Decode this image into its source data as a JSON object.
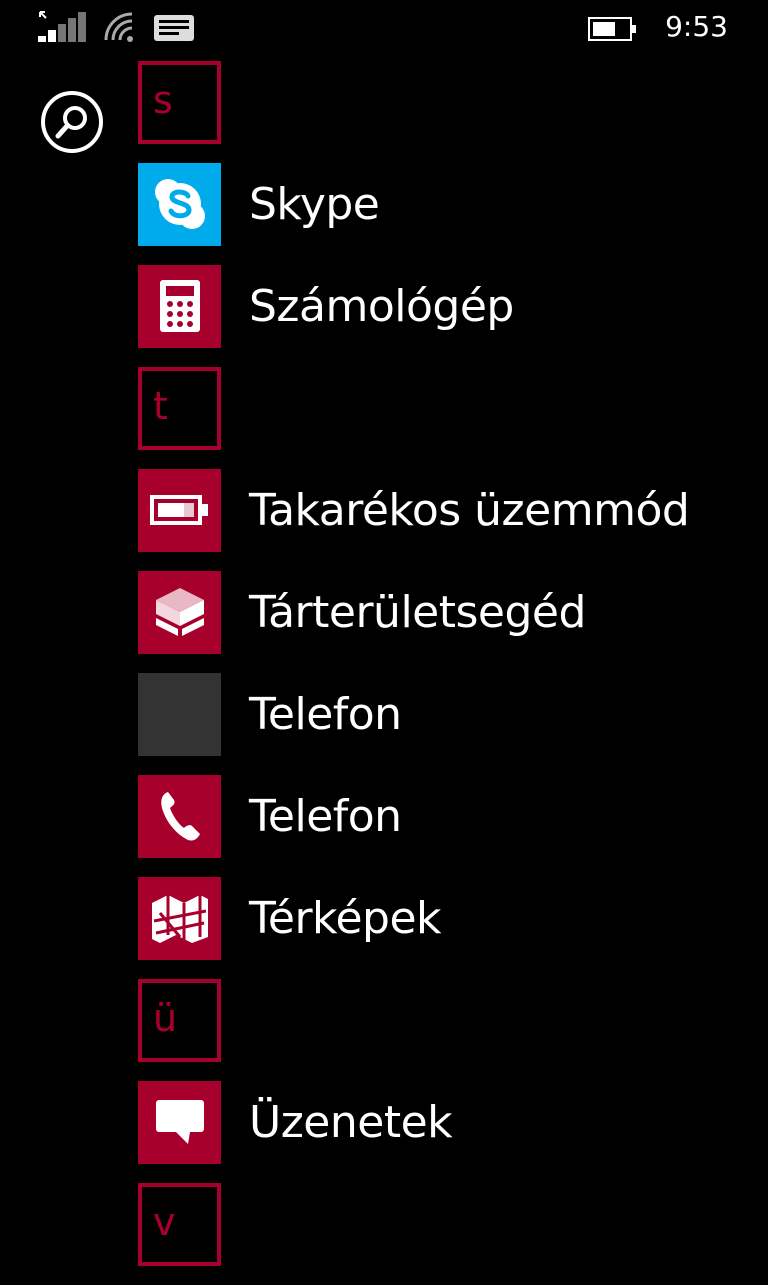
{
  "status_bar": {
    "time": "9:53",
    "icons": [
      "signal-icon",
      "wifi-icon",
      "message-icon",
      "battery-icon"
    ]
  },
  "search": {
    "icon": "search-icon"
  },
  "app_list": {
    "accent_color": "#a8002c",
    "groups": [
      {
        "letter": "s",
        "apps": [
          {
            "name": "Skype",
            "icon": "skype-icon",
            "tile_color": "#00abec"
          },
          {
            "name": "Számológép",
            "icon": "calculator-icon",
            "tile_color": "#a8002c"
          }
        ]
      },
      {
        "letter": "t",
        "apps": [
          {
            "name": "Takarékos üzemmód",
            "icon": "battery-saver-icon",
            "tile_color": "#a8002c"
          },
          {
            "name": "Tárterületsegéd",
            "icon": "storage-sense-icon",
            "tile_color": "#a8002c"
          },
          {
            "name": "Telefon",
            "icon": "blank-tile",
            "tile_color": "#333333"
          },
          {
            "name": "Telefon",
            "icon": "phone-icon",
            "tile_color": "#a8002c"
          },
          {
            "name": "Térképek",
            "icon": "maps-icon",
            "tile_color": "#a8002c"
          }
        ]
      },
      {
        "letter": "ü",
        "apps": [
          {
            "name": "Üzenetek",
            "icon": "messaging-icon",
            "tile_color": "#a8002c"
          }
        ]
      },
      {
        "letter": "v",
        "apps": []
      }
    ]
  }
}
